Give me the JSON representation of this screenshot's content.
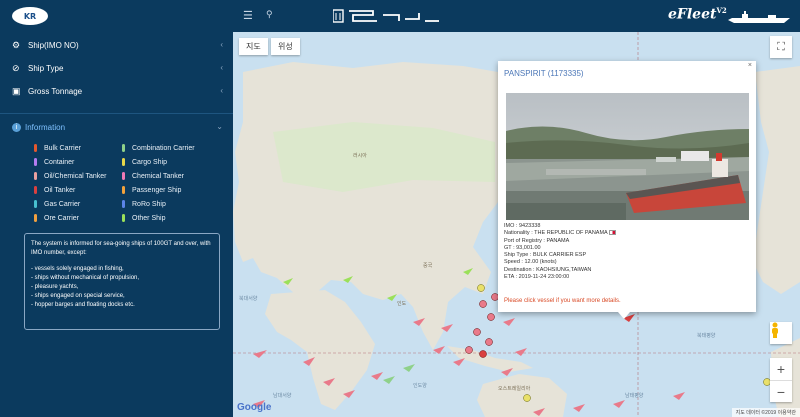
{
  "header": {
    "logo_text": "KR",
    "brand_text": "e",
    "brand_main": "Fleet",
    "brand_version": "V2"
  },
  "sidebar": {
    "menu": [
      {
        "label": "Ship(IMO NO)",
        "icon": "gear-icon"
      },
      {
        "label": "Ship Type",
        "icon": "check-circle-icon"
      },
      {
        "label": "Gross Tonnage",
        "icon": "briefcase-icon"
      }
    ],
    "info_label": "Information",
    "legend": [
      {
        "label": "Bulk Carrier",
        "color": "#e4582e"
      },
      {
        "label": "Combination Carrier",
        "color": "#8fd18a"
      },
      {
        "label": "Container",
        "color": "#b47cf0"
      },
      {
        "label": "Cargo Ship",
        "color": "#e7d84a"
      },
      {
        "label": "Oil/Chemical Tanker",
        "color": "#e8a0a0"
      },
      {
        "label": "Chemical Tanker",
        "color": "#f07ab5"
      },
      {
        "label": "Oil Tanker",
        "color": "#d94040"
      },
      {
        "label": "Passenger Ship",
        "color": "#f2a23c"
      },
      {
        "label": "Gas Carrier",
        "color": "#48c0d0"
      },
      {
        "label": "RoRo Ship",
        "color": "#5b84e8"
      },
      {
        "label": "Ore Carrier",
        "color": "#f0a040"
      },
      {
        "label": "Other Ship",
        "color": "#9be05a"
      }
    ],
    "notice": {
      "intro": "The system is informed for sea-going ships of 100GT and over, with IMO number, except:",
      "items": [
        "- vessels solely engaged in fishing,",
        "- ships without mechanical of propulsion,",
        "- pleasure yachts,",
        "- ships engaged on special service,",
        "- hopper barges and floating docks etc."
      ]
    }
  },
  "map": {
    "tab_map": "지도",
    "tab_satellite": "위성",
    "zoom_in": "+",
    "zoom_out": "−",
    "google": "Google",
    "attribution": "지도 데이터 ©2019   이용약관",
    "labels": {
      "pacific_n": "북태평양",
      "pacific_s": "남태평양",
      "atlantic_n": "북대서양",
      "atlantic_s": "남대서양",
      "indian": "인도양",
      "australia": "오스트레일리아",
      "china": "중국",
      "india": "인도",
      "russia": "러시아"
    }
  },
  "popup": {
    "title": "PANSPIRIT (1173335)",
    "close": "×",
    "details": [
      "IMO : 9423338",
      "Nationality : THE REPUBLIC OF PANAMA",
      "Port of Registry : PANAMA",
      "GT : 93,001.00",
      "Ship Type : BULK CARRIER ESP",
      "Speed : 12.00 (knots)",
      "Destination : KAOHSIUNG,TAIWAN",
      "ETA : 2019-11-24 23:00:00"
    ],
    "more": "Please click vessel if you want more details."
  }
}
